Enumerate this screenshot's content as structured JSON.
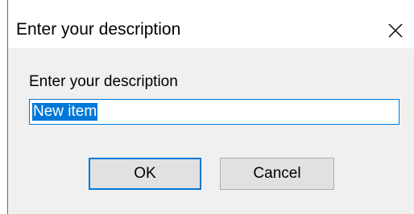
{
  "dialog": {
    "title": "Enter your description",
    "close_icon": "close-icon",
    "prompt": "Enter your description",
    "input_value": "New item",
    "ok_label": "OK",
    "cancel_label": "Cancel"
  },
  "colors": {
    "accent": "#0078d7",
    "dialog_background": "#f0f0f0",
    "button_face": "#e1e1e1"
  }
}
